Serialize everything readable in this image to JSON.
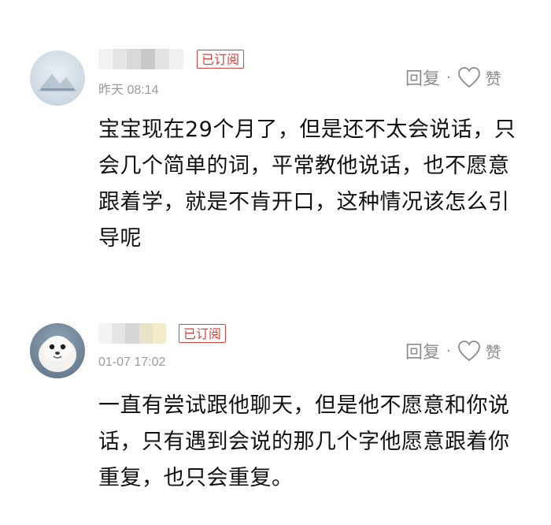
{
  "comments": [
    {
      "badge": "已订阅",
      "time": "昨天 08:14",
      "reply_label": "回复",
      "separator": "·",
      "like_label": "赞",
      "text": "宝宝现在29个月了，但是还不太会说话，只会几个简单的词，平常教他说话，也不愿意跟着学，就是不肯开口，这种情况该怎么引导呢"
    },
    {
      "badge": "已订阅",
      "time": "01-07 17:02",
      "reply_label": "回复",
      "separator": "·",
      "like_label": "赞",
      "text": "一直有尝试跟他聊天，但是他不愿意和你说话，只有遇到会说的那几个字他愿意跟着你重复，也只会重复。"
    }
  ]
}
